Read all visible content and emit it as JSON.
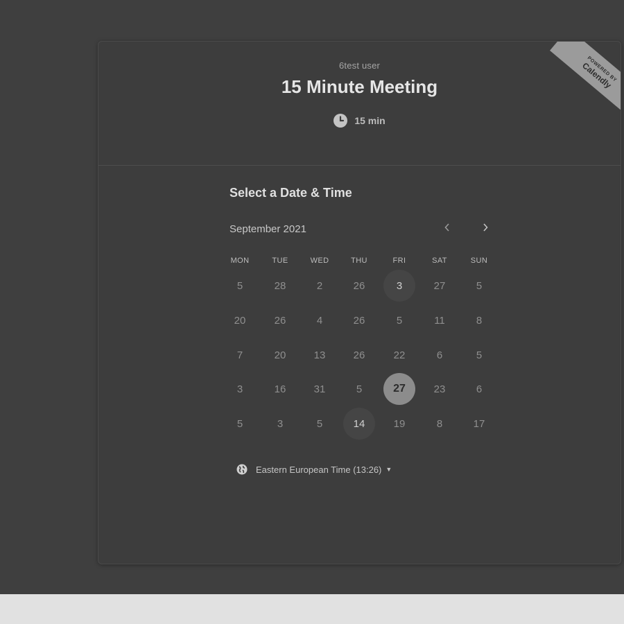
{
  "header": {
    "host_name": "6test user",
    "event_title": "15 Minute Meeting",
    "duration": "15 min"
  },
  "ribbon": {
    "small": "POWERED BY",
    "brand": "Calendly"
  },
  "calendar": {
    "section_title": "Select a Date & Time",
    "month": "September 2021",
    "weekdays": [
      "MON",
      "TUE",
      "WED",
      "THU",
      "FRI",
      "SAT",
      "SUN"
    ],
    "weeks": [
      [
        "5",
        "28",
        "2",
        "26",
        "3",
        "27",
        "5"
      ],
      [
        "20",
        "26",
        "4",
        "26",
        "5",
        "11",
        "8"
      ],
      [
        "7",
        "20",
        "13",
        "26",
        "22",
        "6",
        "5"
      ],
      [
        "3",
        "16",
        "31",
        "5",
        "27",
        "23",
        "6"
      ],
      [
        "5",
        "3",
        "5",
        "14",
        "19",
        "8",
        "17"
      ]
    ],
    "available": [
      [
        0,
        4
      ],
      [
        4,
        3
      ]
    ],
    "selected": [
      3,
      4
    ]
  },
  "timezone": {
    "label": "Eastern European Time (13:26)"
  },
  "icons": {
    "clock": "clock-icon",
    "prev": "chevron-left-icon",
    "next": "chevron-right-icon",
    "globe": "globe-icon",
    "caret": "caret-down-icon"
  }
}
